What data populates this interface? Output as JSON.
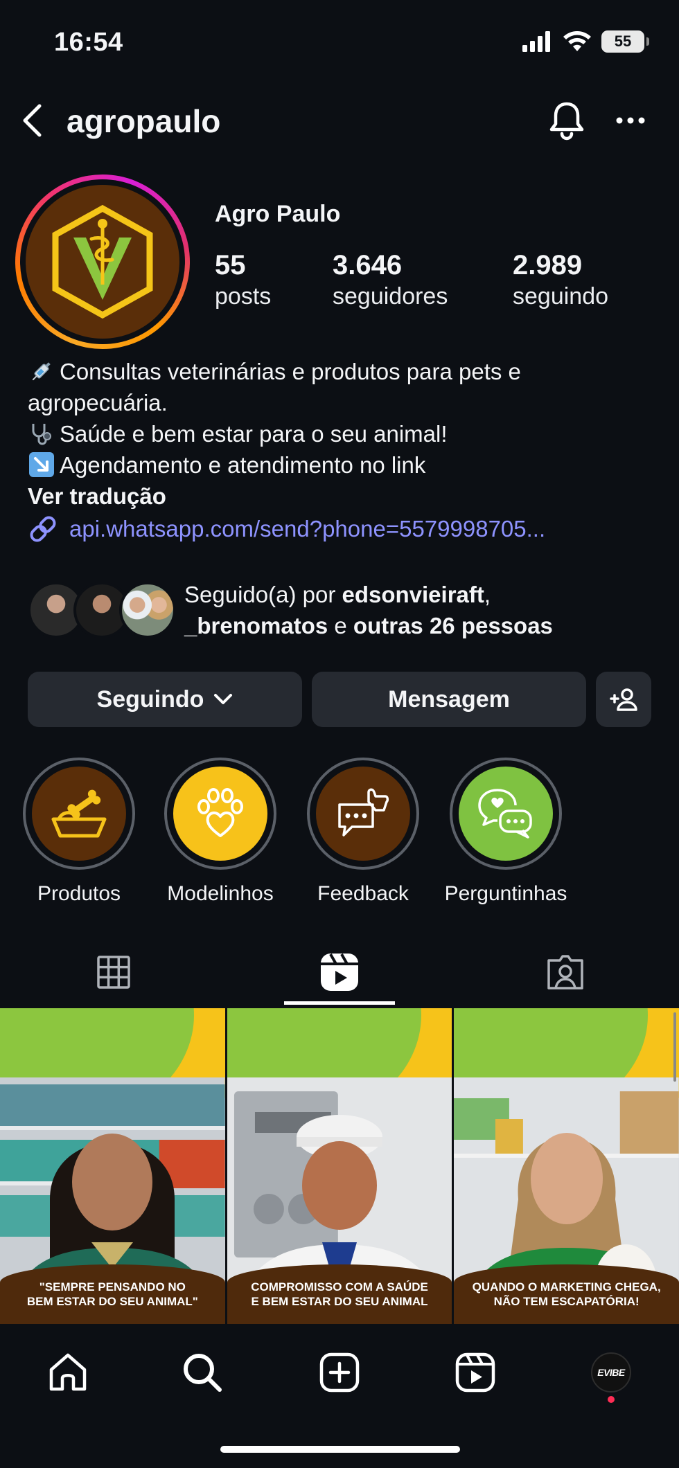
{
  "status_bar": {
    "time": "16:54",
    "battery": "55",
    "icons": [
      "signal-icon",
      "wifi-icon",
      "battery-icon"
    ]
  },
  "header": {
    "username": "agropaulo",
    "icons": [
      "back-arrow-icon",
      "bell-icon",
      "more-icon"
    ]
  },
  "profile": {
    "display_name": "Agro Paulo",
    "stats": [
      {
        "value": "55",
        "label": "posts"
      },
      {
        "value": "3.646",
        "label": "seguidores"
      },
      {
        "value": "2.989",
        "label": "seguindo"
      }
    ],
    "bio": [
      {
        "icon": "syringe-icon",
        "text": "Consultas veterinárias e produtos para pets e"
      },
      {
        "icon": "",
        "text": "agropecuária."
      },
      {
        "icon": "stethoscope-icon",
        "text": "Saúde e bem estar para o seu animal!"
      },
      {
        "icon": "arrow-down-right-icon",
        "text": "Agendamento e atendimento no link"
      }
    ],
    "translate": "Ver tradução",
    "link": "api.whatsapp.com/send?phone=5579998705..."
  },
  "followed_by": {
    "prefix": "Seguido(a) por ",
    "user1": "edsonvieiraft",
    "sep": ",",
    "user2": "_brenomatos",
    "conj": " e ",
    "others": "outras 26 pessoas"
  },
  "actions": {
    "following": "Seguindo",
    "message": "Mensagem"
  },
  "highlights": [
    {
      "label": "Produtos",
      "color": "#5a2e09",
      "icon": "pet-bowl-icon"
    },
    {
      "label": "Modelinhos",
      "color": "#f7c21a",
      "icon": "paw-heart-icon"
    },
    {
      "label": "Feedback",
      "color": "#5a2e09",
      "icon": "chat-thumbs-up-icon"
    },
    {
      "label": "Perguntinhas",
      "color": "#7fc241",
      "icon": "chat-bubbles-icon"
    }
  ],
  "tabs": [
    "grid-icon",
    "reels-icon",
    "tagged-icon"
  ],
  "reels": [
    {
      "caption": "\"SEMPRE PENSANDO NO\nBEM ESTAR DO SEU ANIMAL\""
    },
    {
      "caption": "COMPROMISSO COM A SAÚDE\nE BEM ESTAR DO SEU ANIMAL"
    },
    {
      "caption": "QUANDO O MARKETING CHEGA,\nNÃO TEM ESCAPATÓRIA!"
    }
  ],
  "bottom_nav": {
    "icons": [
      "home-icon",
      "search-icon",
      "create-icon",
      "reels-icon",
      "profile-avatar-icon"
    ],
    "avatar_text": "EVIBE"
  },
  "colors": {
    "background": "#0c0f14",
    "button": "#262a31",
    "link": "#8e93ff",
    "brand_brown": "#5a2e09",
    "brand_green": "#8cc63f",
    "brand_yellow": "#f6c31a"
  }
}
